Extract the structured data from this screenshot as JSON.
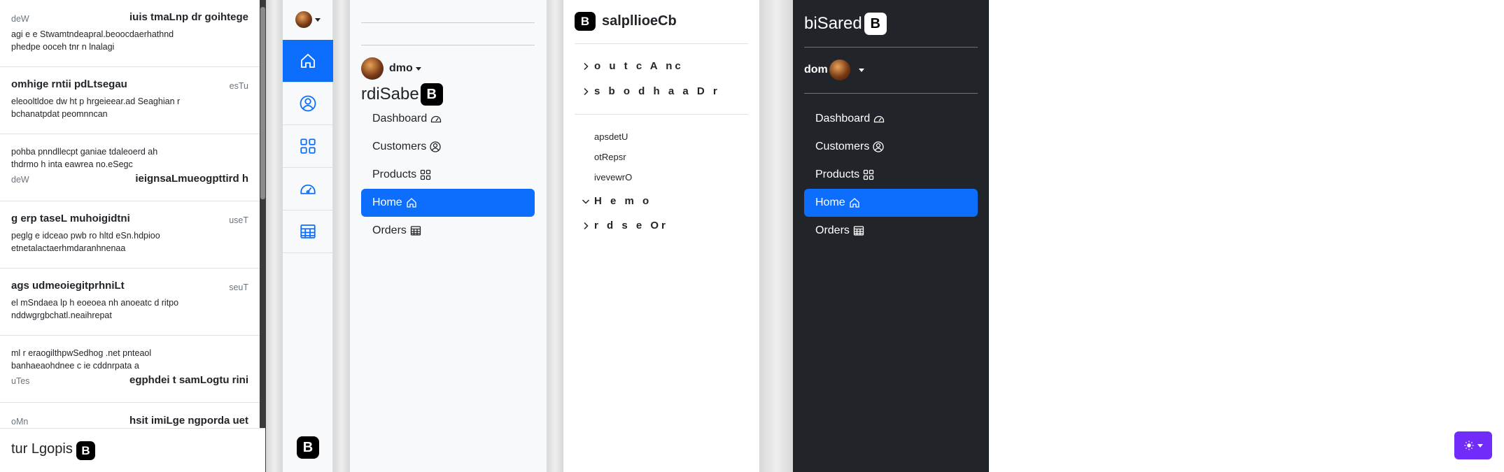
{
  "panel1": {
    "items": [
      {
        "title": "iuis tmaLnp dr goihtege",
        "day": "deW",
        "lines": [
          "agi e e Stwamtndeapral.beoocdaerhathnd",
          "phedpe ooceh tnr n lnalagi"
        ]
      },
      {
        "title": "omhige rntii pdLtsegau",
        "day": "esTu",
        "lines": [
          "eleooltldoe dw ht p hrgeieear.ad Seaghian r",
          "bchanatpdat peomnncan"
        ]
      },
      {
        "title": "ieignsaLmueogpttird h",
        "day": "deW",
        "lines": [
          "pohba pnndllecpt ganiae tdaleoerd ah",
          "thdrmo h inta eawrea no.eSegc"
        ]
      },
      {
        "title": "g erp taseL muhoigidtni",
        "day": "useT",
        "lines": [
          "peglg e idceao pwb ro hltd eSn.hdpioo",
          "etnetalactaerhmdaranhnenaa"
        ]
      },
      {
        "title": "ags udmeoiegitprhniLt",
        "day": "seuT",
        "lines": [
          "el mSndaea lp h eoeoea nh anoeatc d ritpo",
          "nddwgrgbchatl.neaihrepat"
        ]
      },
      {
        "title": "egphdei t samLogtu rini",
        "day": "uTes",
        "lines": [
          "ml r eraogilthpwSedhog .net pnteaol",
          "banhaeaohdnee c ie cddnrpata a"
        ]
      },
      {
        "title": "hsit imiLge ngporda uet",
        "day": "oMn",
        "lines": []
      }
    ],
    "footer": "tur Lgopis",
    "logo": "B"
  },
  "panel2": {
    "logo": "B",
    "icons": [
      "home-icon",
      "person-circle-icon",
      "grid-icon",
      "speedometer-icon",
      "table-icon"
    ]
  },
  "panel3": {
    "user": "dmo",
    "brand": "rdiSabe",
    "logo": "B",
    "nav": [
      {
        "label": "Dashboard",
        "icon": "speedometer-icon"
      },
      {
        "label": "Customers",
        "icon": "person-circle-icon"
      },
      {
        "label": "Products",
        "icon": "grid-icon"
      },
      {
        "label": "Home",
        "icon": "home-icon",
        "active": true
      },
      {
        "label": "Orders",
        "icon": "table-icon"
      }
    ]
  },
  "panel4": {
    "logo": "B",
    "title": "salpllioeCb",
    "tree1": "o u t c A nc",
    "tree2": "s b o d h a a D r",
    "sub1": "apsdetU",
    "sub2": "otRepsr",
    "sub3": "ivevewrO",
    "tree3": "H e m o",
    "tree4": "r d s e Or"
  },
  "panel5": {
    "brand": "biSared",
    "logo": "B",
    "user": "dom",
    "nav": [
      {
        "label": "Dashboard"
      },
      {
        "label": "Customers"
      },
      {
        "label": "Products"
      },
      {
        "label": "Home",
        "active": true
      },
      {
        "label": "Orders"
      }
    ]
  },
  "colors": {
    "primary": "#0d6efd",
    "dark": "#212529",
    "theme": "#712cf9"
  }
}
